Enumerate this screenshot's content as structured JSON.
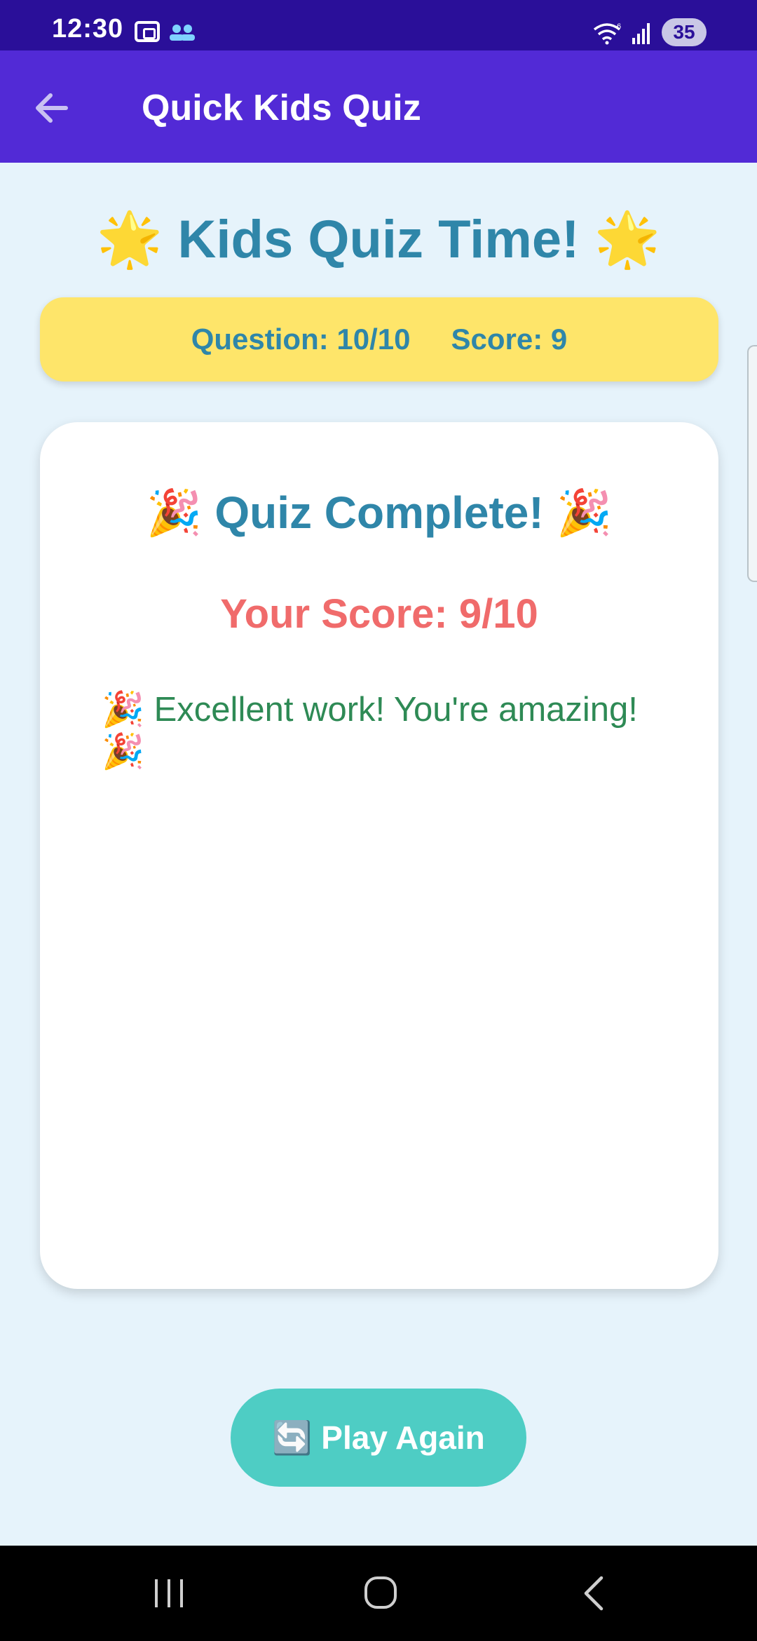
{
  "status_bar": {
    "time": "12:30",
    "battery": "35",
    "icons": [
      "screenshot-icon",
      "people-icon",
      "wifi-icon",
      "signal-icon"
    ]
  },
  "app_bar": {
    "title": "Quick Kids Quiz",
    "back_icon": "arrow-left-icon"
  },
  "header": {
    "title": "🌟 Kids Quiz Time! 🌟"
  },
  "info": {
    "question": "Question: 10/10",
    "score": "Score: 9"
  },
  "result": {
    "title": "🎉 Quiz Complete! 🎉",
    "score": "Your Score: 9/10",
    "message": "🎉 Excellent work! You're amazing! 🎉"
  },
  "actions": {
    "play_again": "🔄 Play Again"
  },
  "nav_bar": {
    "icons": [
      "recents-icon",
      "home-icon",
      "back-icon"
    ]
  },
  "colors": {
    "status_bar": "#2a0f99",
    "app_bar": "#522ad6",
    "background": "#e6f3fb",
    "title_text": "#2f86a9",
    "info_bar": "#fee56a",
    "score_text": "#f06b6b",
    "message_text": "#2e8a55",
    "play_button": "#4ecdc4"
  }
}
